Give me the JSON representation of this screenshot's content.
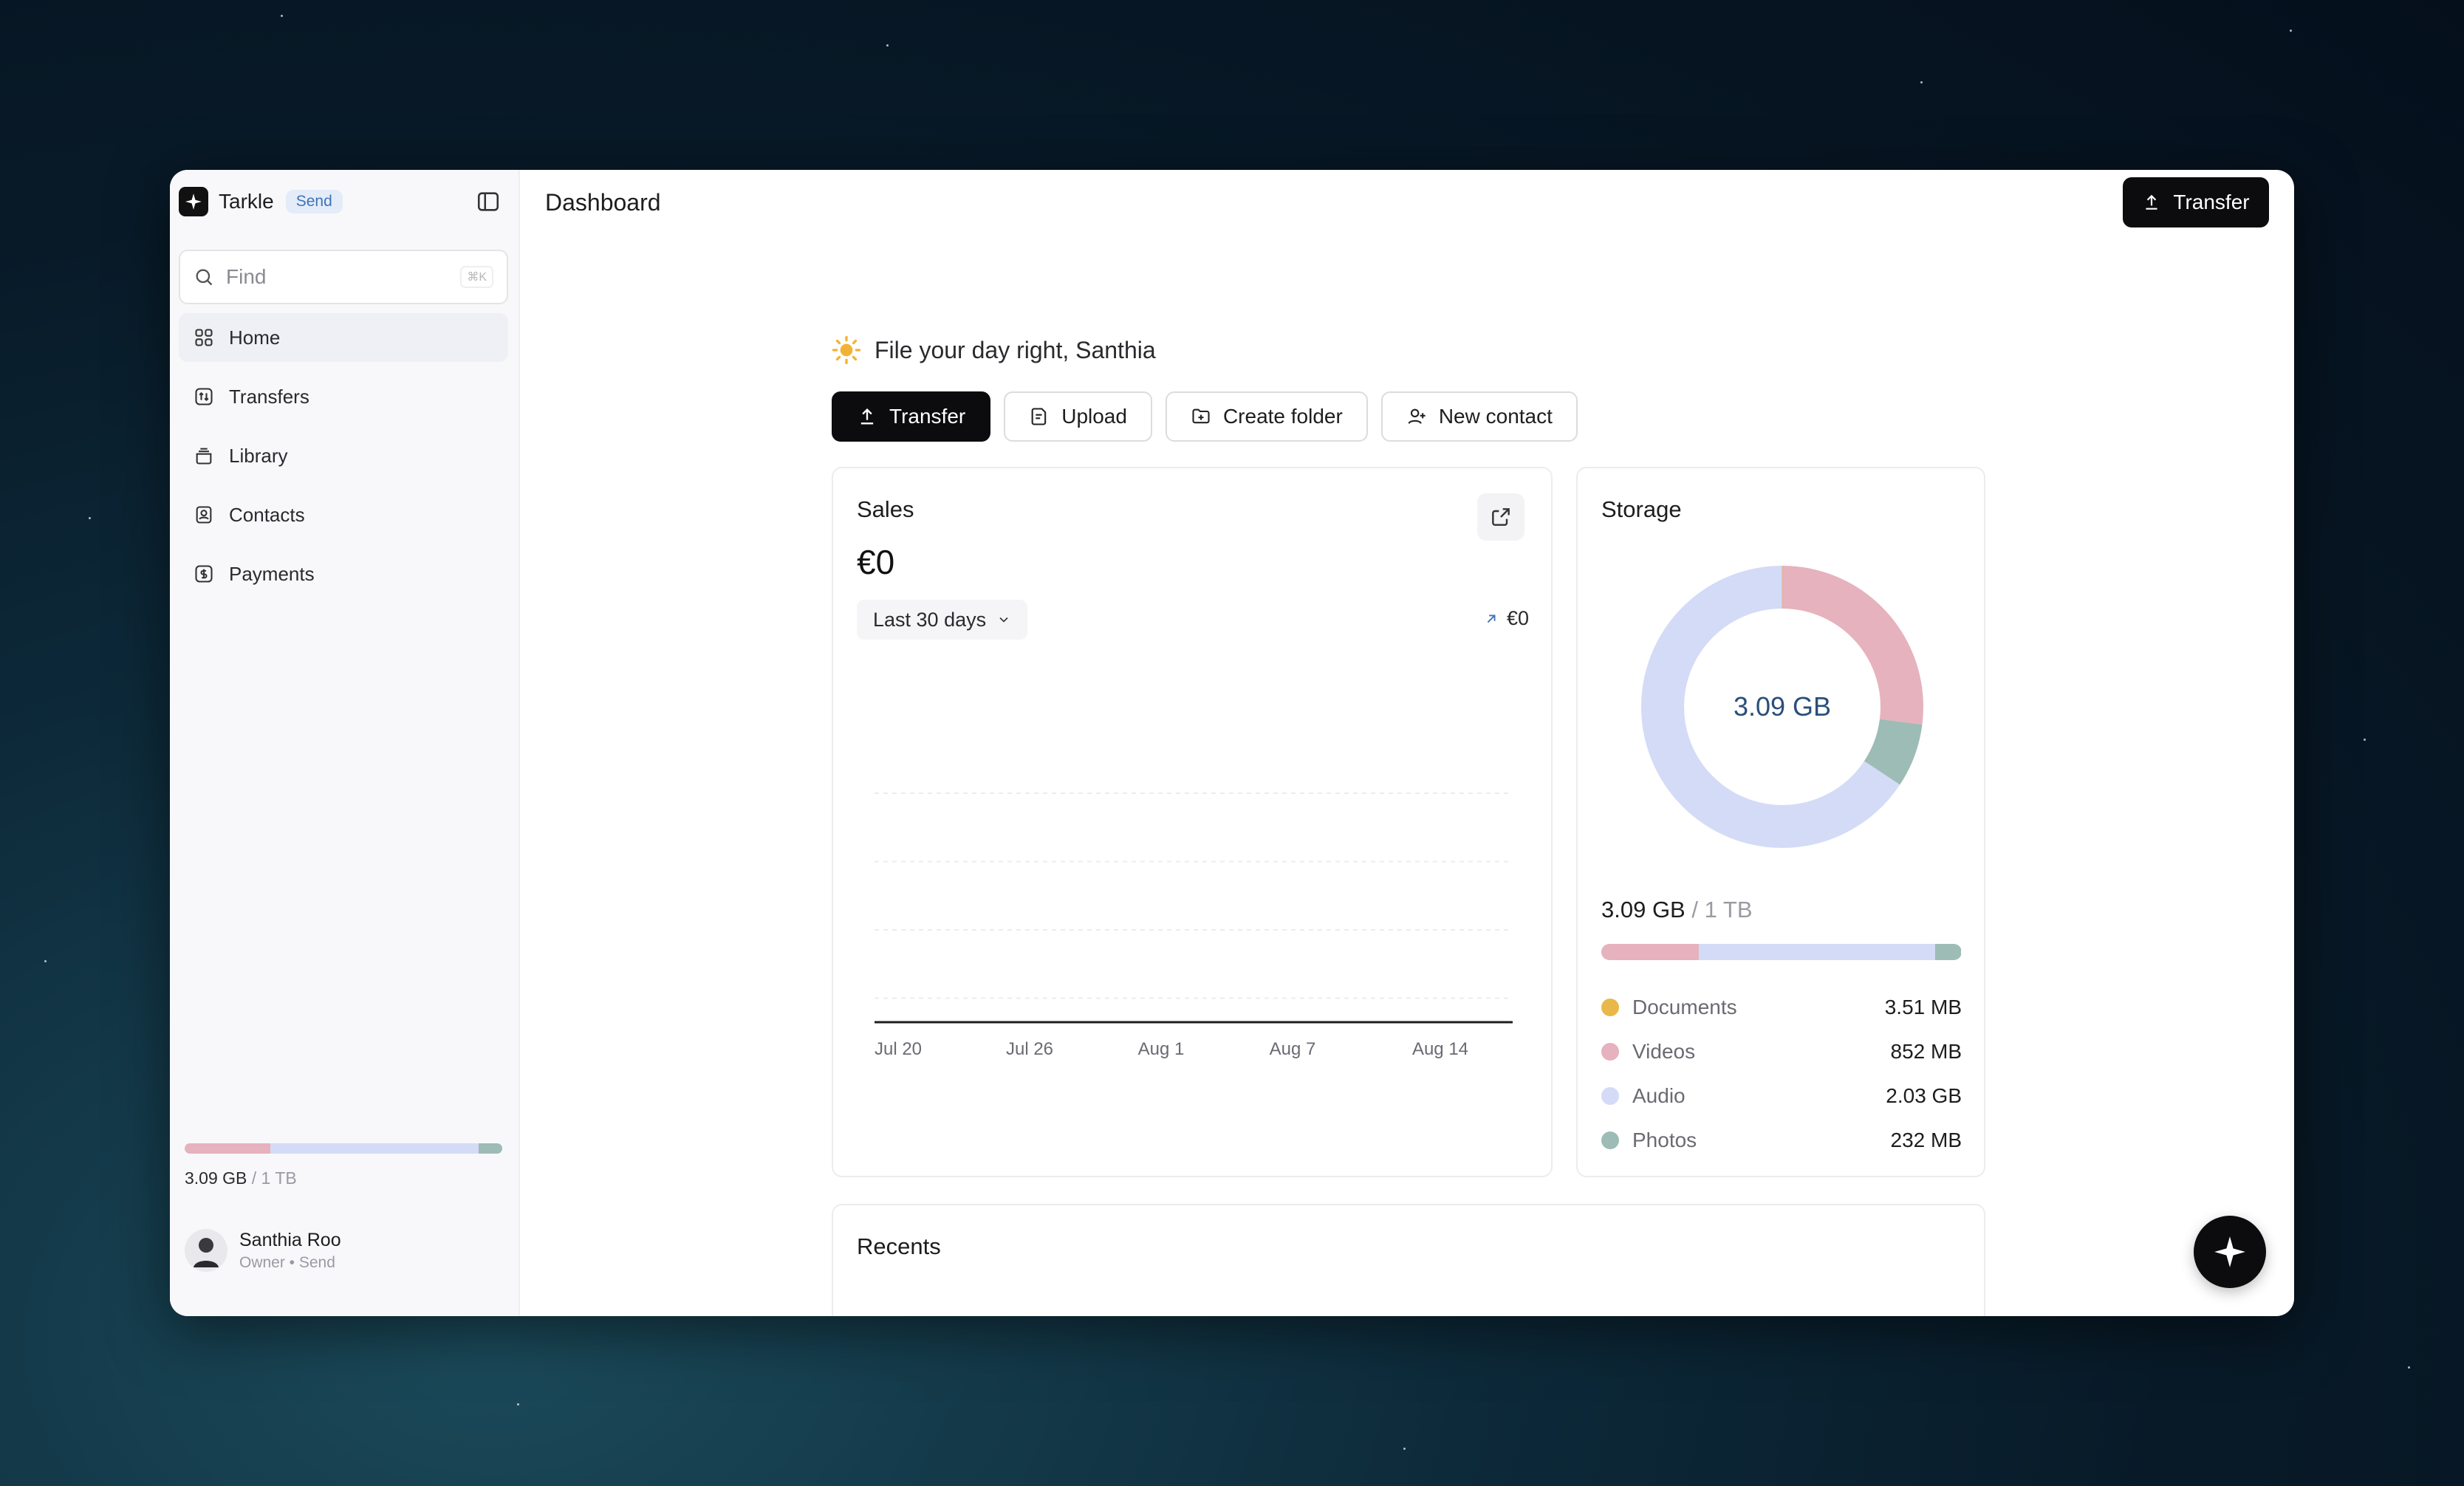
{
  "app": {
    "name": "Tarkle",
    "badge": "Send"
  },
  "search": {
    "placeholder": "Find",
    "shortcut": "⌘K"
  },
  "sidebar": {
    "items": [
      {
        "label": "Home",
        "icon": "grid-icon",
        "active": true
      },
      {
        "label": "Transfers",
        "icon": "transfer-icon"
      },
      {
        "label": "Library",
        "icon": "library-icon"
      },
      {
        "label": "Contacts",
        "icon": "contacts-icon"
      },
      {
        "label": "Payments",
        "icon": "payments-icon"
      }
    ],
    "storage": {
      "used": "3.09 GB",
      "total": "/ 1 TB"
    },
    "user": {
      "name": "Santhia Roo",
      "role": "Owner • Send"
    }
  },
  "header": {
    "title": "Dashboard",
    "transfer_label": "Transfer"
  },
  "greeting": "File your day right, Santhia",
  "actions": {
    "transfer": "Transfer",
    "upload": "Upload",
    "create_folder": "Create folder",
    "new_contact": "New contact"
  },
  "sales": {
    "title": "Sales",
    "value": "€0",
    "range": "Last 30 days",
    "delta": "€0"
  },
  "chart_data": {
    "type": "line",
    "x": [
      "Jul 20",
      "Jul 26",
      "Aug 1",
      "Aug 7",
      "Aug 14"
    ],
    "values": [
      0,
      0,
      0,
      0,
      0
    ],
    "title": "",
    "xlabel": "",
    "ylabel": "",
    "grid": true
  },
  "storage": {
    "title": "Storage",
    "center": "3.09 GB",
    "used": "3.09 GB",
    "total": "/ 1 TB",
    "categories": [
      {
        "label": "Documents",
        "value": "3.51 MB",
        "color": "#e8b94a",
        "fraction": 0.001
      },
      {
        "label": "Videos",
        "value": "852 MB",
        "color": "#e6b2bd",
        "fraction": 0.27
      },
      {
        "label": "Audio",
        "value": "2.03 GB",
        "color": "#d3dbf7",
        "fraction": 0.656
      },
      {
        "label": "Photos",
        "value": "232 MB",
        "color": "#9dbcb5",
        "fraction": 0.073
      }
    ]
  },
  "recents": {
    "title": "Recents"
  }
}
